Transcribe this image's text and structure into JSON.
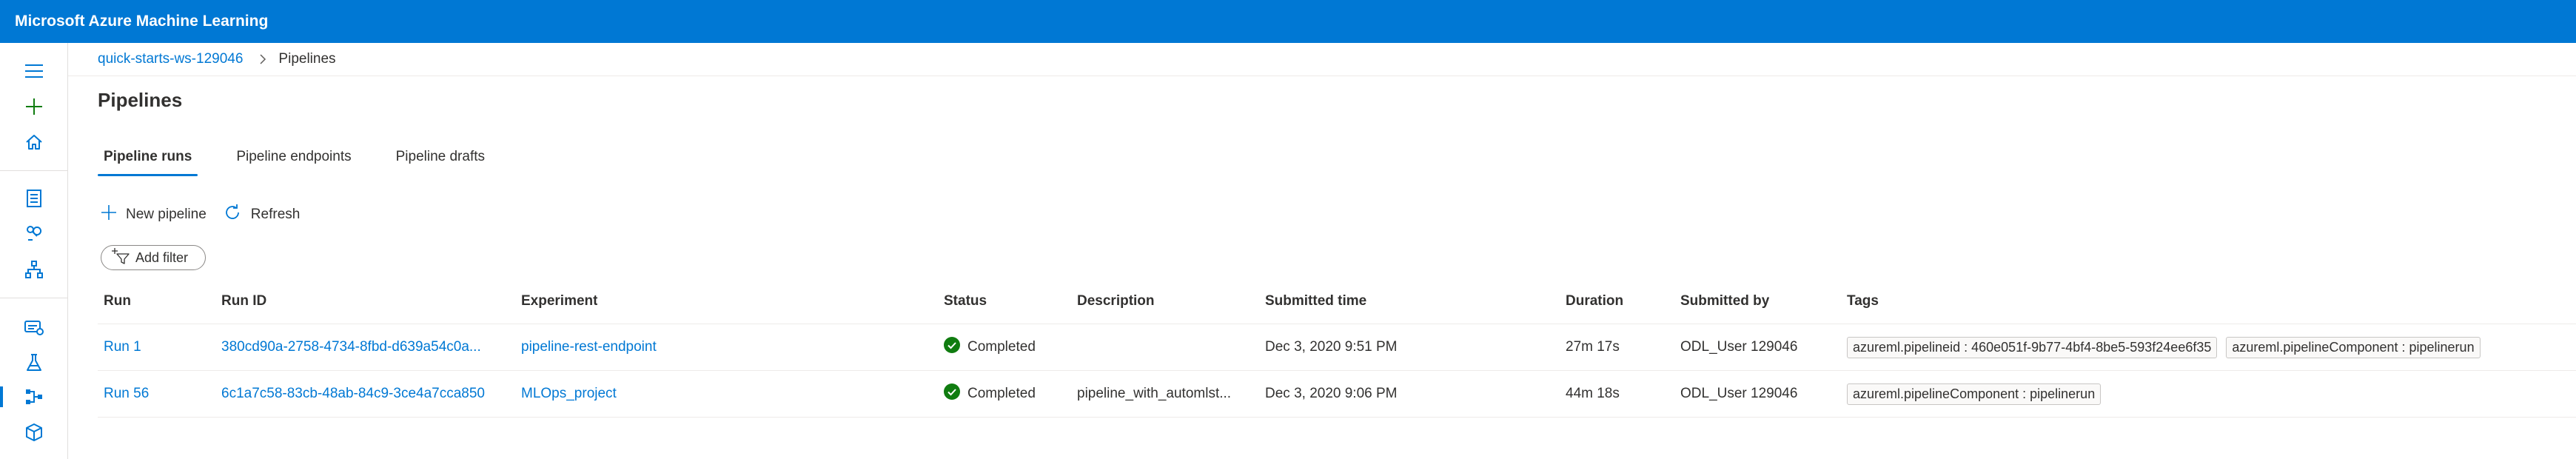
{
  "app": {
    "title": "Microsoft Azure Machine Learning"
  },
  "nav": {
    "icons": [
      "hamburger-icon",
      "plus-icon",
      "home-icon",
      "notebook-icon",
      "automl-icon",
      "designer-icon",
      "datasets-icon",
      "experiments-icon",
      "pipelines-icon",
      "models-icon"
    ],
    "accent": "#0078d4"
  },
  "breadcrumb": {
    "workspace": "quick-starts-ws-129046",
    "current": "Pipelines"
  },
  "page": {
    "title": "Pipelines"
  },
  "tabs": [
    {
      "label": "Pipeline runs",
      "selected": true
    },
    {
      "label": "Pipeline endpoints",
      "selected": false
    },
    {
      "label": "Pipeline drafts",
      "selected": false
    }
  ],
  "commands": {
    "new_pipeline": "New pipeline",
    "refresh": "Refresh"
  },
  "filter": {
    "label": "Add filter"
  },
  "table": {
    "columns": [
      "Run",
      "Run ID",
      "Experiment",
      "Status",
      "Description",
      "Submitted time",
      "Duration",
      "Submitted by",
      "Tags"
    ],
    "rows": [
      {
        "run": "Run 1",
        "run_id": "380cd90a-2758-4734-8fbd-d639a54c0a...",
        "experiment": "pipeline-rest-endpoint",
        "status": "Completed",
        "description": "",
        "submitted_time": "Dec 3, 2020 9:51 PM",
        "duration": "27m 17s",
        "submitted_by": "ODL_User 129046",
        "tags": [
          "azureml.pipelineid : 460e051f-9b77-4bf4-8be5-593f24ee6f35",
          "azureml.pipelineComponent : pipelinerun"
        ]
      },
      {
        "run": "Run 56",
        "run_id": "6c1a7c58-83cb-48ab-84c9-3ce4a7cca850",
        "experiment": "MLOps_project",
        "status": "Completed",
        "description": "pipeline_with_automlst...",
        "submitted_time": "Dec 3, 2020 9:06 PM",
        "duration": "44m 18s",
        "submitted_by": "ODL_User 129046",
        "tags": [
          "azureml.pipelineComponent : pipelinerun"
        ]
      }
    ]
  },
  "colors": {
    "brand": "#0078d4",
    "success": "#107c10"
  }
}
